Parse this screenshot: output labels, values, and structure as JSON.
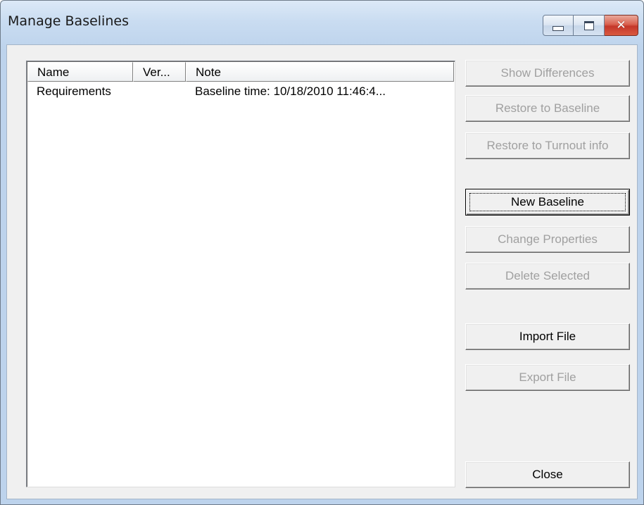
{
  "window": {
    "title": "Manage Baselines",
    "caption_buttons": {
      "minimize_icon": "minimize-icon",
      "maximize_icon": "maximize-icon",
      "close_icon": "close-icon",
      "close_glyph": "✕"
    }
  },
  "list": {
    "columns": [
      "Name",
      "Ver...",
      "Note"
    ],
    "rows": [
      {
        "name": "Requirements",
        "version": "",
        "note": "Baseline time: 10/18/2010 11:46:4..."
      }
    ]
  },
  "buttons": {
    "show_differences": "Show Differences",
    "restore_to_baseline": "Restore to Baseline",
    "restore_to_turnout": "Restore to Turnout info",
    "new_baseline": "New Baseline",
    "change_properties": "Change Properties",
    "delete_selected": "Delete Selected",
    "import_file": "Import File",
    "export_file": "Export File",
    "close": "Close"
  },
  "colors": {
    "disabled_text": "#a0a0a0",
    "close_button_red": "#c4372a",
    "dialog_background": "#f0f0f0"
  }
}
